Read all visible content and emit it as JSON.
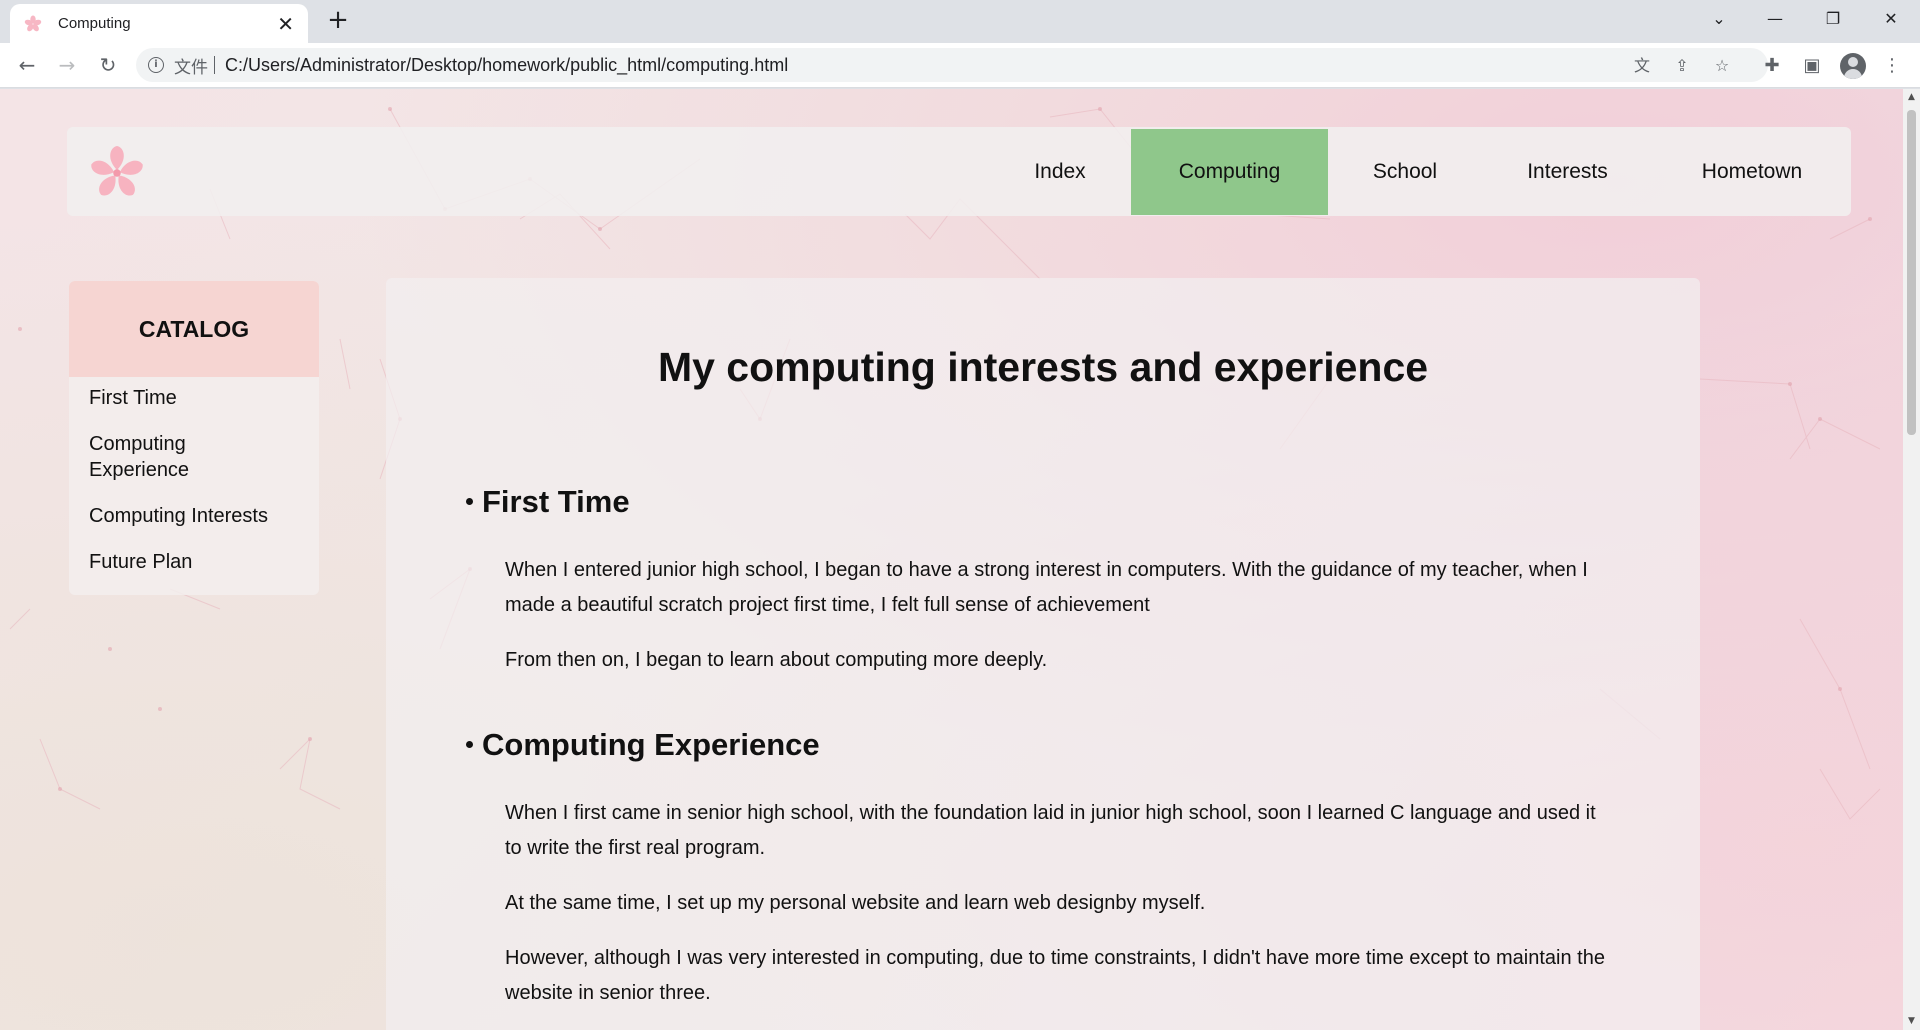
{
  "browser": {
    "tab_title": "Computing",
    "tab_close": "✕",
    "new_tab": "+",
    "address_file_label": "文件",
    "url": "C:/Users/Administrator/Desktop/homework/public_html/computing.html"
  },
  "site": {
    "nav": [
      {
        "label": "Index",
        "active": false
      },
      {
        "label": "Computing",
        "active": true
      },
      {
        "label": "School",
        "active": false
      },
      {
        "label": "Interests",
        "active": false
      },
      {
        "label": "Hometown",
        "active": false
      }
    ],
    "active_nav_color": "#8fc78b",
    "catalog_header_color": "#f6d5d2"
  },
  "sidebar": {
    "title": "CATALOG",
    "items": [
      {
        "label": "First Time"
      },
      {
        "label": "Computing Experience"
      },
      {
        "label": "Computing Interests"
      },
      {
        "label": "Future Plan"
      }
    ]
  },
  "main": {
    "title": "My computing interests and experience",
    "sections": [
      {
        "heading": "First Time",
        "paragraphs": [
          "When I entered junior high school, I began to have a strong interest in computers. With the guidance of my teacher, when I made a beautiful scratch project first time, I felt full sense of achievement",
          "From then on, I began to learn about computing more deeply."
        ]
      },
      {
        "heading": "Computing Experience",
        "paragraphs": [
          "When I first came in senior high school, with the foundation laid in junior high school, soon I learned C language and used it to write the first real program.",
          "At the same time, I set up my personal website and learn web designby myself.",
          "However, although I was very interested in computing, due to time constraints, I didn't have more time except to maintain the website in senior three."
        ]
      }
    ]
  },
  "icons": {
    "logo": "cherry-blossom-icon",
    "favicon": "cherry-blossom-icon"
  }
}
